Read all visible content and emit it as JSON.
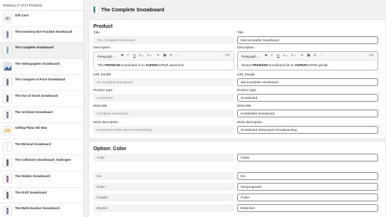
{
  "sidebar": {
    "header": "Showing 17 of 17 Products",
    "items": [
      {
        "name": "Gift Card",
        "thumb": "gift-card",
        "color": "#c9c9c9"
      },
      {
        "name": "The Inventory Not Tracked Snowboard",
        "thumb": "snowboard",
        "color": "#6c3fb8"
      },
      {
        "name": "The Complete Snowboard",
        "thumb": "snowboard",
        "color": "#2aa7a0",
        "selected": true
      },
      {
        "name": "The Videographer Snowboard",
        "thumb": "photo",
        "color": "#4a6fa5"
      },
      {
        "name": "The Compare at Price Snowboard",
        "thumb": "snowboard",
        "color": "#3c3c8c"
      },
      {
        "name": "The Out of Stock Snowboard",
        "thumb": "snowboard",
        "color": "#2d2d2d"
      },
      {
        "name": "The Archived Snowboard",
        "thumb": "snowboard",
        "color": "#5a5a8a"
      },
      {
        "name": "Selling Plans Ski Wax",
        "thumb": "wax",
        "color": "#e0a020"
      },
      {
        "name": "The Minimal Snowboard",
        "thumb": "snowboard",
        "color": "#eaeaea"
      },
      {
        "name": "The Collection Snowboard: Hydrogen",
        "thumb": "snowboard",
        "color": "#1f2a44"
      },
      {
        "name": "The Hidden Snowboard",
        "thumb": "snowboard",
        "color": "#8a2a7a"
      },
      {
        "name": "The Draft Snowboard",
        "thumb": "snowboard",
        "color": "#3a3a3a"
      },
      {
        "name": "The Multi-location Snowboard",
        "thumb": "snowboard",
        "color": "#4b4bb0"
      }
    ]
  },
  "page": {
    "title": "The Complete Snowboard"
  },
  "product": {
    "heading": "Product",
    "left": {
      "title_label": "Title",
      "title_value": "The Complete Snowboard",
      "description_label": "Description",
      "description_parts": [
        "This ",
        "PREMIUM",
        " snowboard is so ",
        "SUPER",
        "DUPER awesome!"
      ],
      "handle_label": "URL handle",
      "handle_value": "the-complete-snowboard",
      "type_label": "Product type",
      "type_value": "snowboard",
      "meta_title_label": "Meta title",
      "meta_title_value": "Complete Snowboard",
      "meta_desc_label": "Meta description",
      "meta_desc_value": "snowboard winter sport snowboarding"
    },
    "right": {
      "title_label": "Title",
      "title_value": "Das komplette Snowboard",
      "description_label": "Description",
      "description_parts": [
        "Dieses ",
        "PREMIUM",
        " Snowboard ist so ",
        "SUPER",
        "DUPER genial!"
      ],
      "handle_label": "URL handle",
      "handle_value": "das-komplette-snowboard",
      "type_label": "Product type",
      "type_value": "Snowboard",
      "meta_title_label": "Meta title",
      "meta_title_value": "Komplettes Snowboard",
      "meta_desc_label": "Meta description",
      "meta_desc_value": "Snowboard Wintersport Snowboarding"
    },
    "editor": {
      "paragraph_label": "Paragraph"
    }
  },
  "option": {
    "heading": "Option: Color",
    "name_source": "Color",
    "name_value": "Farbe",
    "values": [
      {
        "source": "Ice",
        "target": "Eis"
      },
      {
        "source": "Dawn",
        "target": "Morgengrauen"
      },
      {
        "source": "Powder",
        "target": "Puder"
      },
      {
        "source": "Electric",
        "target": "Elektrisch"
      }
    ]
  },
  "colors": {
    "accent": "#303030",
    "readonly_bg": "#f3f3f3",
    "border": "#8a8a8a"
  }
}
